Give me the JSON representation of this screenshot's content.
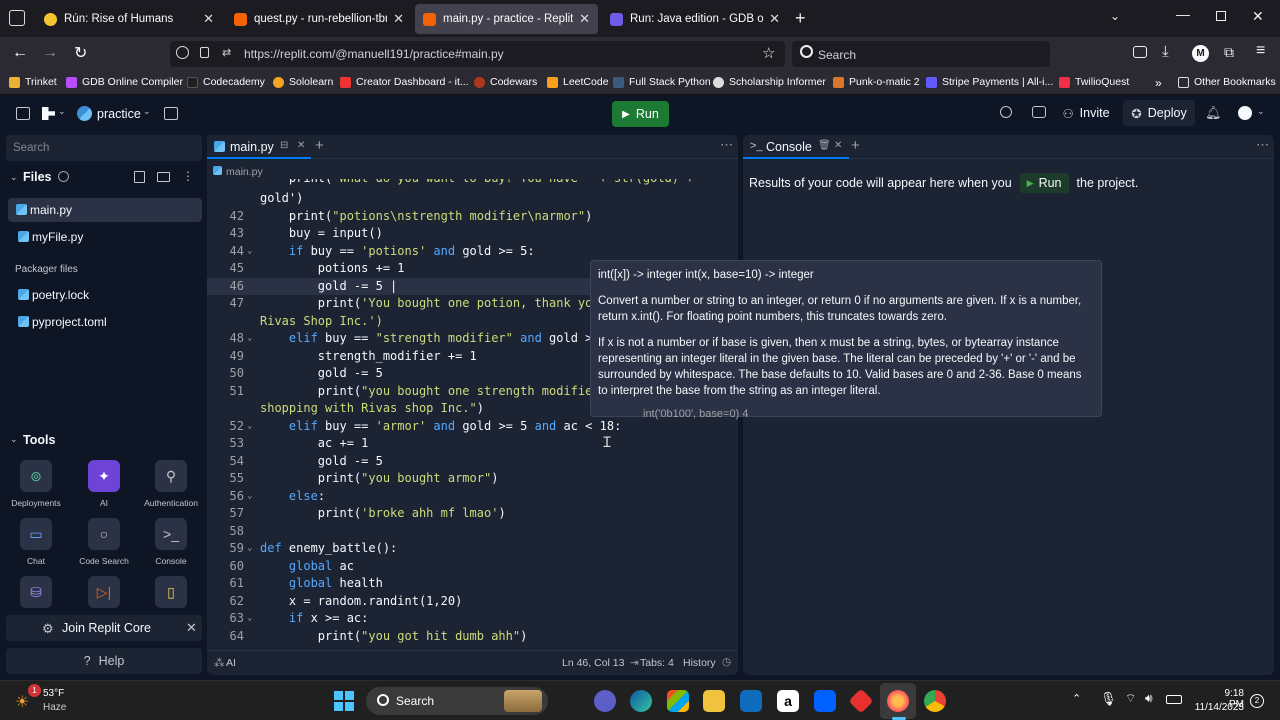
{
  "browser": {
    "tabs": [
      {
        "title": "Rún: Rise of Humans",
        "color": "#f4c430"
      },
      {
        "title": "quest.py - run-rebellion-tbrpg",
        "color": "#f26207"
      },
      {
        "title": "main.py - practice - Replit",
        "color": "#f26207"
      },
      {
        "title": "Run: Java edition - GDB online D",
        "color": "#6c5ce7"
      }
    ],
    "url": "https://replit.com/@manuell191/practice#main.py",
    "search_placeholder": "Search",
    "profile_initial": "M",
    "bookmarks": [
      "Trinket",
      "GDB Online Compiler",
      "Codecademy",
      "Sololearn",
      "Creator Dashboard - it...",
      "Codewars",
      "LeetCode",
      "Full Stack Python",
      "Scholarship Informer",
      "Punk-o-matic 2",
      "Stripe Payments | All-i...",
      "TwilioQuest"
    ],
    "other_bookmarks": "Other Bookmarks"
  },
  "replit": {
    "project": "practice",
    "run_label": "Run",
    "invite": "Invite",
    "deploy": "Deploy",
    "search_placeholder": "Search",
    "files_label": "Files",
    "files": [
      "main.py",
      "myFile.py"
    ],
    "packager_label": "Packager files",
    "packager_files": [
      "poetry.lock",
      "pyproject.toml"
    ],
    "tools_label": "Tools",
    "tools": [
      "Deployments",
      "AI",
      "Authentication",
      "Chat",
      "Code Search",
      "Console"
    ],
    "join_core": "Join Replit Core",
    "help": "Help"
  },
  "editor": {
    "tab": "main.py",
    "breadcrumb": "main.py",
    "status_ai": "AI",
    "status_pos": "Ln 46, Col 13",
    "status_tabs": "Tabs: 4",
    "status_history": "History",
    "lines": [
      {
        "n": "",
        "fold": "",
        "html": "gold')"
      },
      {
        "n": "42",
        "fold": "",
        "html": "    print(<span class=\"s\">\"potions\\nstrength modifier\\narmor\"</span>)"
      },
      {
        "n": "43",
        "fold": "",
        "html": "    buy = input()"
      },
      {
        "n": "44",
        "fold": "⌄",
        "html": "    <span class=\"k\">if</span> buy == <span class=\"s\">'potions'</span> <span class=\"k\">and</span> gold &gt;= 5:"
      },
      {
        "n": "45",
        "fold": "",
        "html": "        potions += 1"
      },
      {
        "n": "46",
        "fold": "",
        "html": "        gold -= 5 |"
      },
      {
        "n": "47",
        "fold": "",
        "html": "        print(<span class=\"s\">'You bought one potion, thank you</span>"
      },
      {
        "n": "",
        "fold": "",
        "html": "<span class=\"s\">Rivas Shop Inc.')</span>"
      },
      {
        "n": "48",
        "fold": "⌄",
        "html": "    <span class=\"k\">elif</span> buy == <span class=\"s\">\"strength modifier\"</span> <span class=\"k\">and</span> gold &gt;="
      },
      {
        "n": "49",
        "fold": "",
        "html": "        strength_modifier += 1"
      },
      {
        "n": "50",
        "fold": "",
        "html": "        gold -= 5"
      },
      {
        "n": "51",
        "fold": "",
        "html": "        print(<span class=\"s\">\"you bought one strength modifier</span>"
      },
      {
        "n": "",
        "fold": "",
        "html": "<span class=\"s\">shopping with Rivas shop Inc.\"</span>)"
      },
      {
        "n": "52",
        "fold": "⌄",
        "html": "    <span class=\"k\">elif</span> buy == <span class=\"s\">'armor'</span> <span class=\"k\">and</span> gold &gt;= 5 <span class=\"k\">and</span> ac &lt; 18:"
      },
      {
        "n": "53",
        "fold": "",
        "html": "        ac += 1"
      },
      {
        "n": "54",
        "fold": "",
        "html": "        gold -= 5"
      },
      {
        "n": "55",
        "fold": "",
        "html": "        print(<span class=\"s\">\"you bought armor\"</span>)"
      },
      {
        "n": "56",
        "fold": "⌄",
        "html": "    <span class=\"k\">else</span>:"
      },
      {
        "n": "57",
        "fold": "",
        "html": "        print(<span class=\"s\">'broke ahh mf lmao'</span>)"
      },
      {
        "n": "58",
        "fold": "",
        "html": ""
      },
      {
        "n": "59",
        "fold": "⌄",
        "html": "<span class=\"k\">def</span> enemy_battle():"
      },
      {
        "n": "60",
        "fold": "",
        "html": "    <span class=\"k\">global</span> ac"
      },
      {
        "n": "61",
        "fold": "",
        "html": "    <span class=\"k\">global</span> health"
      },
      {
        "n": "62",
        "fold": "",
        "html": "    x = random.randint(1,20)"
      },
      {
        "n": "63",
        "fold": "⌄",
        "html": "    <span class=\"k\">if</span> x &gt;= ac:"
      },
      {
        "n": "64",
        "fold": "",
        "html": "        print(<span class=\"s\">\"you got hit dumb ahh\"</span>)"
      }
    ]
  },
  "tooltip": {
    "signature": "int([x]) -> integer int(x, base=10) -> integer",
    "p1": "Convert a number or string to an integer, or return 0 if no arguments are given.  If x is a number, return x.int().  For floating point numbers, this truncates towards zero.",
    "p2": "If x is not a number or if base is given, then x must be a string, bytes, or bytearray instance representing an integer literal in the given base.  The literal can be preceded by '+' or '-' and be surrounded by whitespace.  The base defaults to 10.  Valid bases are 0 and 2-36. Base 0 means to interpret the base from the string as an integer literal.",
    "example": "int('0b100', base=0) 4"
  },
  "console": {
    "tab": "Console",
    "msg_before": "Results of your code will appear here when you",
    "run": "Run",
    "msg_after": "the project."
  },
  "taskbar": {
    "weather_temp": "53°F",
    "weather_desc": "Haze",
    "search": "Search",
    "time": "9:18 PM",
    "date": "11/14/2023",
    "notif_count": "2",
    "weather_badge": "1"
  }
}
